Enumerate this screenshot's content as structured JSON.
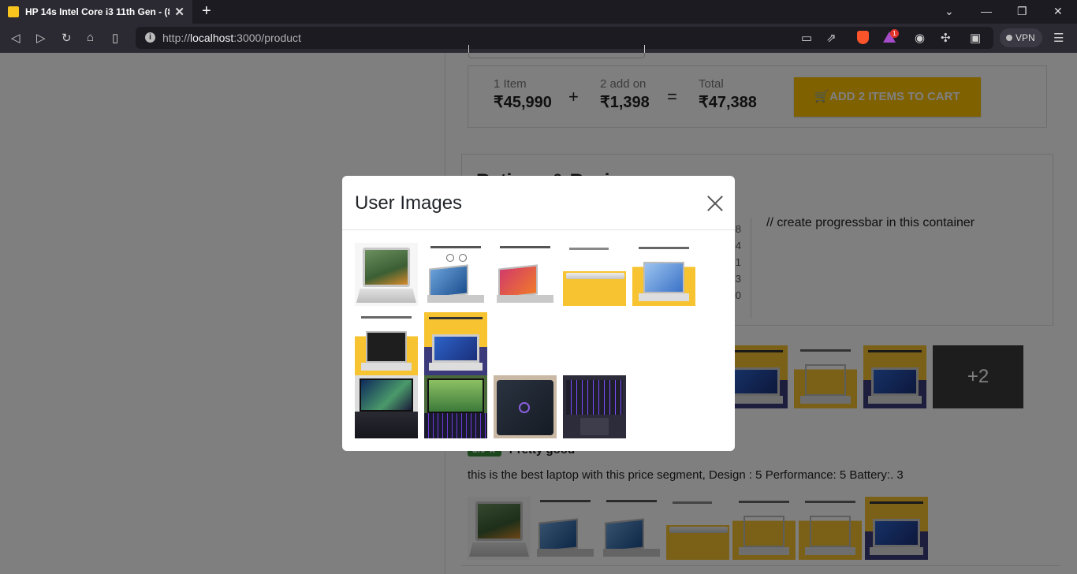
{
  "browser": {
    "tab_title": "HP 14s Intel Core i3 11th Gen - (8",
    "tab_close": "✕",
    "new_tab": "+",
    "url_host": "localhost",
    "url_prefix": "http://",
    "url_suffix": ":3000/product",
    "vpn_label": "VPN",
    "brave_badge": "1",
    "icons": [
      "back-icon",
      "forward-icon",
      "reload-icon",
      "home-icon",
      "bookmark-icon",
      "cast-icon",
      "share-icon",
      "brave-shield-icon",
      "rewards-icon",
      "profile-icon",
      "extensions-icon",
      "wallet-icon",
      "menu-icon"
    ]
  },
  "combo": {
    "item_label": "1 Item",
    "item_price": "₹45,990",
    "addon_label": "2 add on",
    "addon_price": "₹1,398",
    "total_label": "Total",
    "total_price": "₹47,388",
    "plus": "+",
    "equals": "=",
    "add_button": "ADD 2 ITEMS TO CART"
  },
  "ratings": {
    "title": "Ratings & Reviews",
    "digits": [
      "8",
      "4",
      "1",
      "3",
      "0"
    ],
    "progress_note": "// create progressbar in this container"
  },
  "gallery": {
    "more_label": "+2"
  },
  "review": {
    "rating": "5.0 ★",
    "title": "Pretty good",
    "text": "this is the best laptop with this price segment, Design : 5 Performance: 5 Battery:. 3"
  },
  "modal": {
    "title": "User Images",
    "close_icon": "close-icon"
  },
  "colors": {
    "accent_yellow": "#ffc200",
    "rating_green": "#388e3c",
    "chrome_dark": "#1c1b22"
  }
}
